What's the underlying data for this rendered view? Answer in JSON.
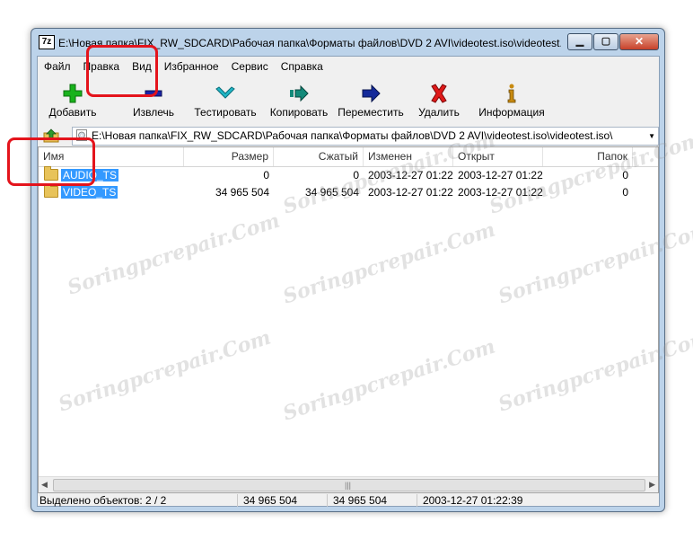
{
  "window": {
    "title": "E:\\Новая папка\\FIX_RW_SDCARD\\Рабочая папка\\Форматы файлов\\DVD 2 AVI\\videotest.iso\\videotest.is...",
    "app_icon_text": "7z"
  },
  "caption_buttons": {
    "minimize": "▁",
    "maximize": "▢",
    "close": "✕"
  },
  "menu": [
    "Файл",
    "Правка",
    "Вид",
    "Избранное",
    "Сервис",
    "Справка"
  ],
  "toolbar": {
    "add": "Добавить",
    "extract": "Извлечь",
    "test": "Тестировать",
    "copy": "Копировать",
    "move": "Переместить",
    "delete": "Удалить",
    "info": "Информация"
  },
  "toolbar_icons": {
    "add": "plus-icon",
    "extract": "minus-icon",
    "test": "checkmark-icon",
    "copy": "copy-arrow-icon",
    "move": "arrow-right-icon",
    "delete": "x-icon",
    "info": "info-icon"
  },
  "colors": {
    "add": "#19b21c",
    "extract": "#1a23a8",
    "test": "#1fb6c6",
    "copy": "#138a7a",
    "move": "#142a9a",
    "delete": "#e01919",
    "info": "#c88a10",
    "highlight": "#e4141c",
    "selection": "#3399ff"
  },
  "address": {
    "path": "E:\\Новая папка\\FIX_RW_SDCARD\\Рабочая папка\\Форматы файлов\\DVD 2 AVI\\videotest.iso\\videotest.iso\\"
  },
  "columns": {
    "name": "Имя",
    "size": "Размер",
    "packed": "Сжатый",
    "modified": "Изменен",
    "created": "Открыт",
    "folders": "Папок"
  },
  "rows": [
    {
      "name": "AUDIO_TS",
      "size": "0",
      "packed": "0",
      "modified": "2003-12-27 01:22",
      "created": "2003-12-27 01:22",
      "folders": "0"
    },
    {
      "name": "VIDEO_TS",
      "size": "34 965 504",
      "packed": "34 965 504",
      "modified": "2003-12-27 01:22",
      "created": "2003-12-27 01:22",
      "folders": "0"
    }
  ],
  "status": {
    "selected": "Выделено объектов: 2 / 2",
    "size": "34 965 504",
    "packed": "34 965 504",
    "date": "2003-12-27 01:22:39"
  },
  "watermark": "Soringpcrepair.Com"
}
